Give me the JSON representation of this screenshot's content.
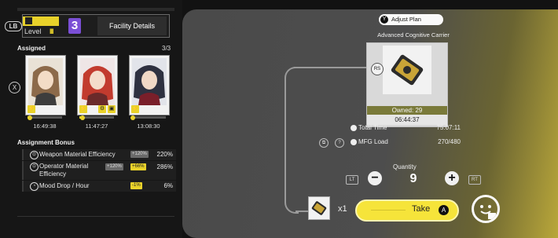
{
  "header": {
    "lb_badge": "LB",
    "level_label": "Level",
    "level_bars": "III",
    "level_number": "3",
    "facility_details_label": "Facility Details"
  },
  "assigned": {
    "title": "Assigned",
    "count": "3/3",
    "remove_badge": "X"
  },
  "operators": [
    {
      "time": "16:49:38",
      "progress": 0.06
    },
    {
      "time": "11:47:27",
      "progress": 0.1
    },
    {
      "time": "13:08:30",
      "progress": 0.05
    }
  ],
  "bonus": {
    "title": "Assignment Bonus",
    "items": [
      {
        "label": "Weapon Material Efficiency",
        "chips": [
          "+120%"
        ],
        "percent": "220%"
      },
      {
        "label": "Operator Material Efficiency",
        "chips": [
          "+120%",
          "+66%"
        ],
        "percent": "286%"
      },
      {
        "label": "Mood Drop / Hour",
        "chips": [
          "-1%"
        ],
        "percent": "6%"
      }
    ]
  },
  "production": {
    "adjust_badge": "Y",
    "adjust_label": "Adjust Plan",
    "product_name": "Advanced Cognitive Carrier",
    "rs_badge": "RS",
    "owned": "Owned: 29",
    "timer": "06:44:37",
    "total_time_label": "Total Time",
    "total_time_value": "75:07:11",
    "mfg_load_label": "MFG Load",
    "mfg_load_value": "270/480",
    "help_badge": "?",
    "quantity_label": "Quantity",
    "lt_badge": "LT",
    "rt_badge": "RT",
    "minus_label": "−",
    "plus_label": "+",
    "quantity_value": "9",
    "take_multiplier": "x1",
    "take_label": "Take",
    "take_badge": "A"
  },
  "colors": {
    "accent": "#e9d22a",
    "level_purple": "#7b4fd6",
    "take_button": "#f6e43a"
  }
}
